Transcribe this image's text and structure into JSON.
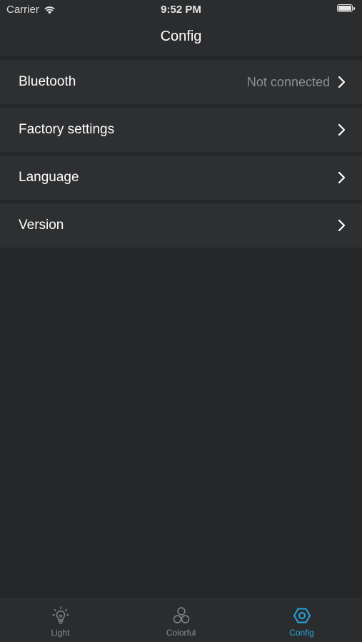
{
  "status_bar": {
    "carrier": "Carrier",
    "time": "9:52 PM",
    "wifi_icon": "wifi-icon",
    "battery_icon": "battery-full-icon"
  },
  "nav": {
    "title": "Config"
  },
  "settings": {
    "items": [
      {
        "label": "Bluetooth",
        "value": "Not connected"
      },
      {
        "label": "Factory settings",
        "value": ""
      },
      {
        "label": "Language",
        "value": ""
      },
      {
        "label": "Version",
        "value": ""
      }
    ],
    "chevron_icon": "chevron-right-icon"
  },
  "tabs": [
    {
      "label": "Light",
      "icon": "lightbulb-icon",
      "active": false
    },
    {
      "label": "Colorful",
      "icon": "three-circles-icon",
      "active": false
    },
    {
      "label": "Config",
      "icon": "hexagon-nut-icon",
      "active": true
    }
  ],
  "colors": {
    "background": "#252628",
    "row_background": "#2e2f31",
    "bar_background": "#2b2c2e",
    "accent": "#26a6dd",
    "muted_text": "#8e8f91"
  }
}
